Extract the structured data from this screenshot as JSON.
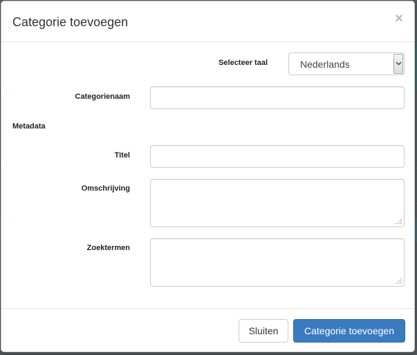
{
  "modal": {
    "title": "Categorie toevoegen",
    "close_symbol": "×"
  },
  "form": {
    "language_label": "Selecteer taal",
    "language_value": "Nederlands",
    "category_name_label": "Categorienaam",
    "category_name_value": "",
    "metadata_section": "Metadata",
    "title_label": "Titel",
    "title_value": "",
    "description_label": "Omschrijving",
    "description_value": "",
    "keywords_label": "Zoektermen",
    "keywords_value": ""
  },
  "footer": {
    "close_label": "Sluiten",
    "submit_label": "Categorie toevoegen"
  },
  "colors": {
    "primary": "#3a7bc0",
    "backdrop": "#545a5e"
  }
}
